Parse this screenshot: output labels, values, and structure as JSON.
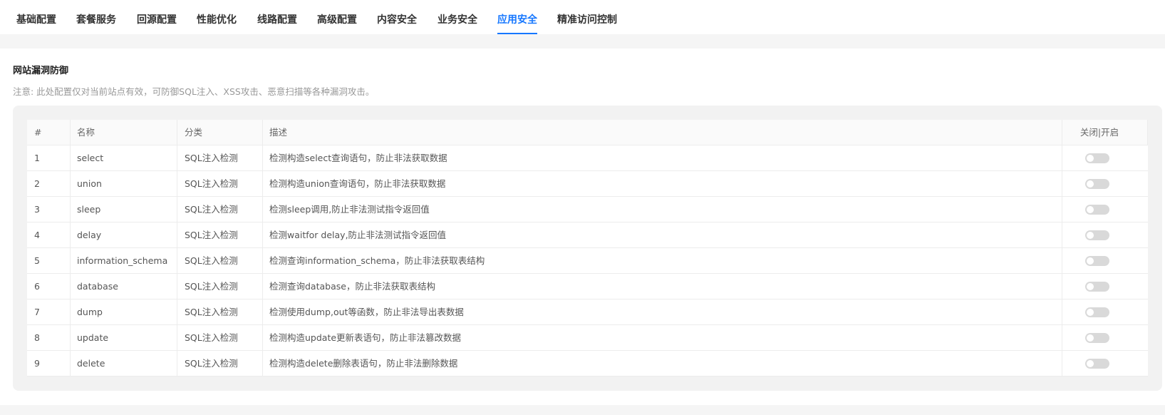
{
  "tabs": [
    {
      "label": "基础配置",
      "active": false
    },
    {
      "label": "套餐服务",
      "active": false
    },
    {
      "label": "回源配置",
      "active": false
    },
    {
      "label": "性能优化",
      "active": false
    },
    {
      "label": "线路配置",
      "active": false
    },
    {
      "label": "高级配置",
      "active": false
    },
    {
      "label": "内容安全",
      "active": false
    },
    {
      "label": "业务安全",
      "active": false
    },
    {
      "label": "应用安全",
      "active": true
    },
    {
      "label": "精准访问控制",
      "active": false
    }
  ],
  "section": {
    "title": "网站漏洞防御",
    "note": "注意: 此处配置仅对当前站点有效，可防御SQL注入、XSS攻击、恶意扫描等各种漏洞攻击。"
  },
  "table": {
    "headers": {
      "idx": "#",
      "name": "名称",
      "category": "分类",
      "desc": "描述",
      "switch": "关闭|开启"
    },
    "rows": [
      {
        "idx": "1",
        "name": "select",
        "category": "SQL注入检测",
        "desc": "检测构造select查询语句，防止非法获取数据",
        "enabled": false
      },
      {
        "idx": "2",
        "name": "union",
        "category": "SQL注入检测",
        "desc": "检测构造union查询语句，防止非法获取数据",
        "enabled": false
      },
      {
        "idx": "3",
        "name": "sleep",
        "category": "SQL注入检测",
        "desc": "检测sleep调用,防止非法测试指令返回值",
        "enabled": false
      },
      {
        "idx": "4",
        "name": "delay",
        "category": "SQL注入检测",
        "desc": "检测waitfor delay,防止非法测试指令返回值",
        "enabled": false
      },
      {
        "idx": "5",
        "name": "information_schema",
        "category": "SQL注入检测",
        "desc": "检测查询information_schema，防止非法获取表结构",
        "enabled": false
      },
      {
        "idx": "6",
        "name": "database",
        "category": "SQL注入检测",
        "desc": "检测查询database，防止非法获取表结构",
        "enabled": false
      },
      {
        "idx": "7",
        "name": "dump",
        "category": "SQL注入检测",
        "desc": "检测使用dump,out等函数，防止非法导出表数据",
        "enabled": false
      },
      {
        "idx": "8",
        "name": "update",
        "category": "SQL注入检测",
        "desc": "检测构造update更新表语句，防止非法篡改数据",
        "enabled": false
      },
      {
        "idx": "9",
        "name": "delete",
        "category": "SQL注入检测",
        "desc": "检测构造delete删除表语句，防止非法删除数据",
        "enabled": false
      }
    ]
  },
  "colors": {
    "accent": "#1677ff",
    "toggle_off": "#d9d9d9"
  }
}
